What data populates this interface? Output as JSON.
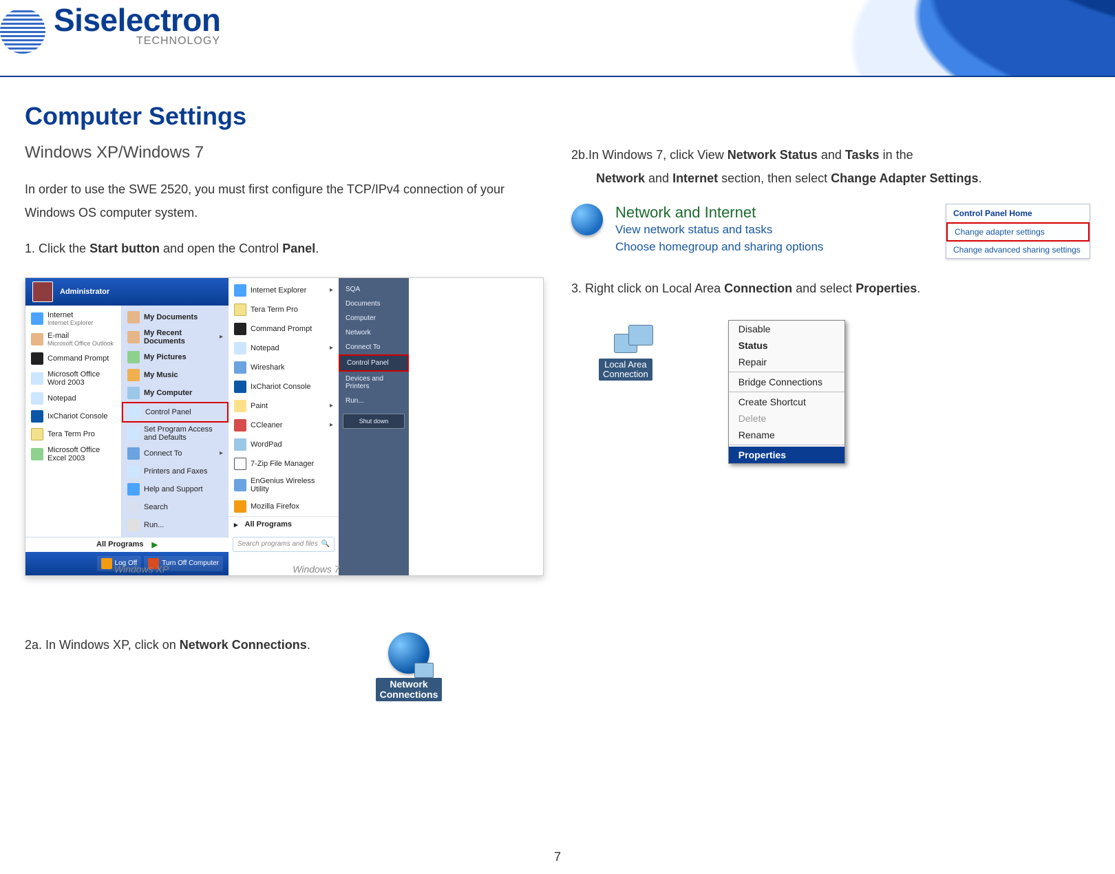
{
  "brand": {
    "name": "Siselectron",
    "sub": "TECHNOLOGY"
  },
  "h1": "Computer Settings",
  "h2": "Windows  XP/Windows 7",
  "intro": {
    "p1a": "In order  to  use  the  SWE 2520, you  must  first ",
    "p1b": "configure the TCP/IPv4 connection of your Windows OS computer system."
  },
  "step1": {
    "num": "1.",
    "a": "Click the  ",
    "b": "Start button",
    "c": " and  open  the  Control  ",
    "d": "Panel",
    "e": "."
  },
  "xp": {
    "header_user": "Administrator",
    "left": [
      {
        "label": "Internet",
        "sub": "Internet Explorer"
      },
      {
        "label": "E-mail",
        "sub": "Microsoft Office Outlook"
      },
      {
        "label": "Command Prompt"
      },
      {
        "label": "Microsoft Office Word 2003"
      },
      {
        "label": "Notepad"
      },
      {
        "label": "IxChariot Console"
      },
      {
        "label": "Tera Term Pro"
      },
      {
        "label": "Microsoft Office Excel 2003"
      }
    ],
    "right": [
      {
        "label": "My Documents"
      },
      {
        "label": "My Recent Documents",
        "arrow": true
      },
      {
        "label": "My Pictures"
      },
      {
        "label": "My Music"
      },
      {
        "label": "My Computer"
      },
      {
        "label": "Control Panel",
        "highlight": true
      },
      {
        "label": "Set Program Access and Defaults"
      },
      {
        "label": "Connect To",
        "arrow": true
      },
      {
        "label": "Printers and Faxes"
      },
      {
        "label": "Help and Support"
      },
      {
        "label": "Search"
      },
      {
        "label": "Run..."
      }
    ],
    "all_programs": "All Programs",
    "log_off": "Log Off",
    "turn_off": "Turn Off Computer",
    "caption": "Windows XP"
  },
  "w7": {
    "left": [
      {
        "label": "Internet Explorer",
        "cls": "c-ie",
        "arrow": true
      },
      {
        "label": "Tera Term Pro",
        "cls": "c-tt"
      },
      {
        "label": "Command Prompt",
        "cls": "c-cmd"
      },
      {
        "label": "Notepad",
        "cls": "c-np",
        "arrow": true
      },
      {
        "label": "Wireshark",
        "cls": "c-ws"
      },
      {
        "label": "IxChariot Console",
        "cls": "c-ix"
      },
      {
        "label": "Paint",
        "cls": "c-pt",
        "arrow": true
      },
      {
        "label": "CCleaner",
        "cls": "c-cc",
        "arrow": true
      },
      {
        "label": "WordPad",
        "cls": "c-wp"
      },
      {
        "label": "7-Zip File Manager",
        "cls": "c-7z"
      },
      {
        "label": "EnGenius Wireless Utility",
        "cls": "c-eg"
      },
      {
        "label": "Mozilla Firefox",
        "cls": "c-ff"
      }
    ],
    "all_programs": "All Programs",
    "search_placeholder": "Search programs and files",
    "side": [
      "SQA",
      "Documents",
      "Computer",
      "Network",
      "Connect To",
      {
        "label": "Control Panel",
        "highlight": true
      },
      "Devices and Printers",
      "Run..."
    ],
    "side_btn1": "Shut down",
    "caption": "Windows 7"
  },
  "step2a": {
    "a": "2a. In Windows XP, click on ",
    "b": "Network Connections",
    "c": "."
  },
  "nc_label_l1": "Network",
  "nc_label_l2": "Connections",
  "step2b": {
    "pre": "2b.",
    "a": "In   Windows  7,   click  View  ",
    "b": "Network  Status",
    "c": "  and   ",
    "d": "Tasks",
    "e": "  in  the ",
    "f": "Network",
    "g": " and   ",
    "h": "Internet",
    "i": " section, then   select   ",
    "j": "Change Adapter Settings",
    "k": "."
  },
  "ni": {
    "title": "Network and Internet",
    "line1": "View network status and tasks",
    "line2": "Choose homegroup and sharing options"
  },
  "cp_side": {
    "head": "Control Panel Home",
    "row_hl": "Change adapter settings",
    "row2": "Change advanced sharing settings"
  },
  "step3": {
    "a": "3.  Right click on Local Area ",
    "b": "Connection",
    "c": " and  select ",
    "d": "Properties",
    "e": "."
  },
  "lac_l1": "Local Area",
  "lac_l2": "Connection",
  "ctx": [
    "Disable",
    "Status",
    "Repair",
    "",
    "Bridge Connections",
    "",
    "Create Shortcut",
    "Delete",
    "Rename",
    "",
    "Properties"
  ],
  "ctx_bold": "Status",
  "ctx_dis": "Delete",
  "ctx_prop": "Properties",
  "page_number": "7"
}
